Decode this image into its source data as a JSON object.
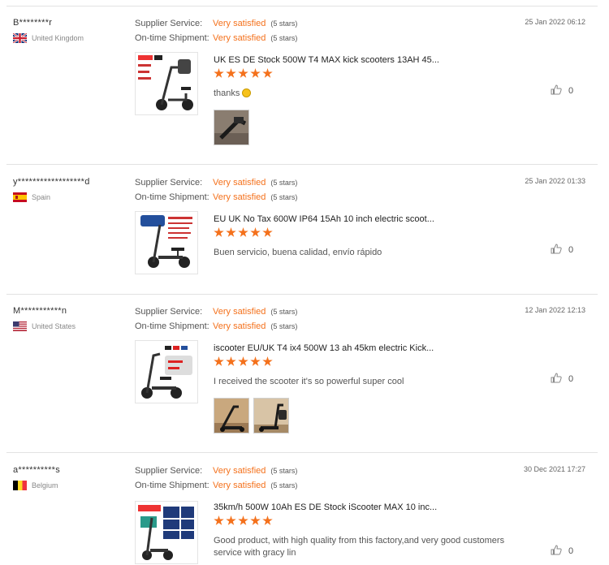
{
  "labels": {
    "supplier_service": "Supplier Service:",
    "shipment": "On-time Shipment:"
  },
  "reviews": [
    {
      "user": "B********r",
      "country": "United Kingdom",
      "flag": "uk",
      "supplier_value": "Very satisfied",
      "supplier_stars": "(5 stars)",
      "shipment_value": "Very satisfied",
      "shipment_stars": "(5 stars)",
      "date": "25 Jan 2022 06:12",
      "product": "UK ES DE Stock 500W T4 MAX kick scooters 13AH 45...",
      "rating": 5,
      "text": "thanks",
      "likes": "0",
      "photos": 1
    },
    {
      "user": "y******************d",
      "country": "Spain",
      "flag": "es",
      "supplier_value": "Very satisfied",
      "supplier_stars": "(5 stars)",
      "shipment_value": "Very satisfied",
      "shipment_stars": "(5 stars)",
      "date": "25 Jan 2022 01:33",
      "product": "EU UK No Tax 600W IP64 15Ah 10 inch electric scoot...",
      "rating": 5,
      "text": "Buen servicio, buena calidad, envío rápido",
      "likes": "0",
      "photos": 0
    },
    {
      "user": "M***********n",
      "country": "United States",
      "flag": "us",
      "supplier_value": "Very satisfied",
      "supplier_stars": "(5 stars)",
      "shipment_value": "Very satisfied",
      "shipment_stars": "(5 stars)",
      "date": "12 Jan 2022 12:13",
      "product": "iscooter EU/UK T4 ix4 500W 13 ah 45km electric Kick...",
      "rating": 5,
      "text": "I received the scooter it's so powerful super cool",
      "likes": "0",
      "photos": 2
    },
    {
      "user": "a**********s",
      "country": "Belgium",
      "flag": "be",
      "supplier_value": "Very satisfied",
      "supplier_stars": "(5 stars)",
      "shipment_value": "Very satisfied",
      "shipment_stars": "(5 stars)",
      "date": "30 Dec 2021 17:27",
      "product": "35km/h 500W 10Ah ES DE Stock iScooter MAX 10 inc...",
      "rating": 5,
      "text": "Good product, with high quality from this factory,and very good customers service with gracy lin",
      "likes": "0",
      "photos": 0
    }
  ],
  "colors": {
    "accent": "#f4711c",
    "separator": "#e2e2e2"
  }
}
